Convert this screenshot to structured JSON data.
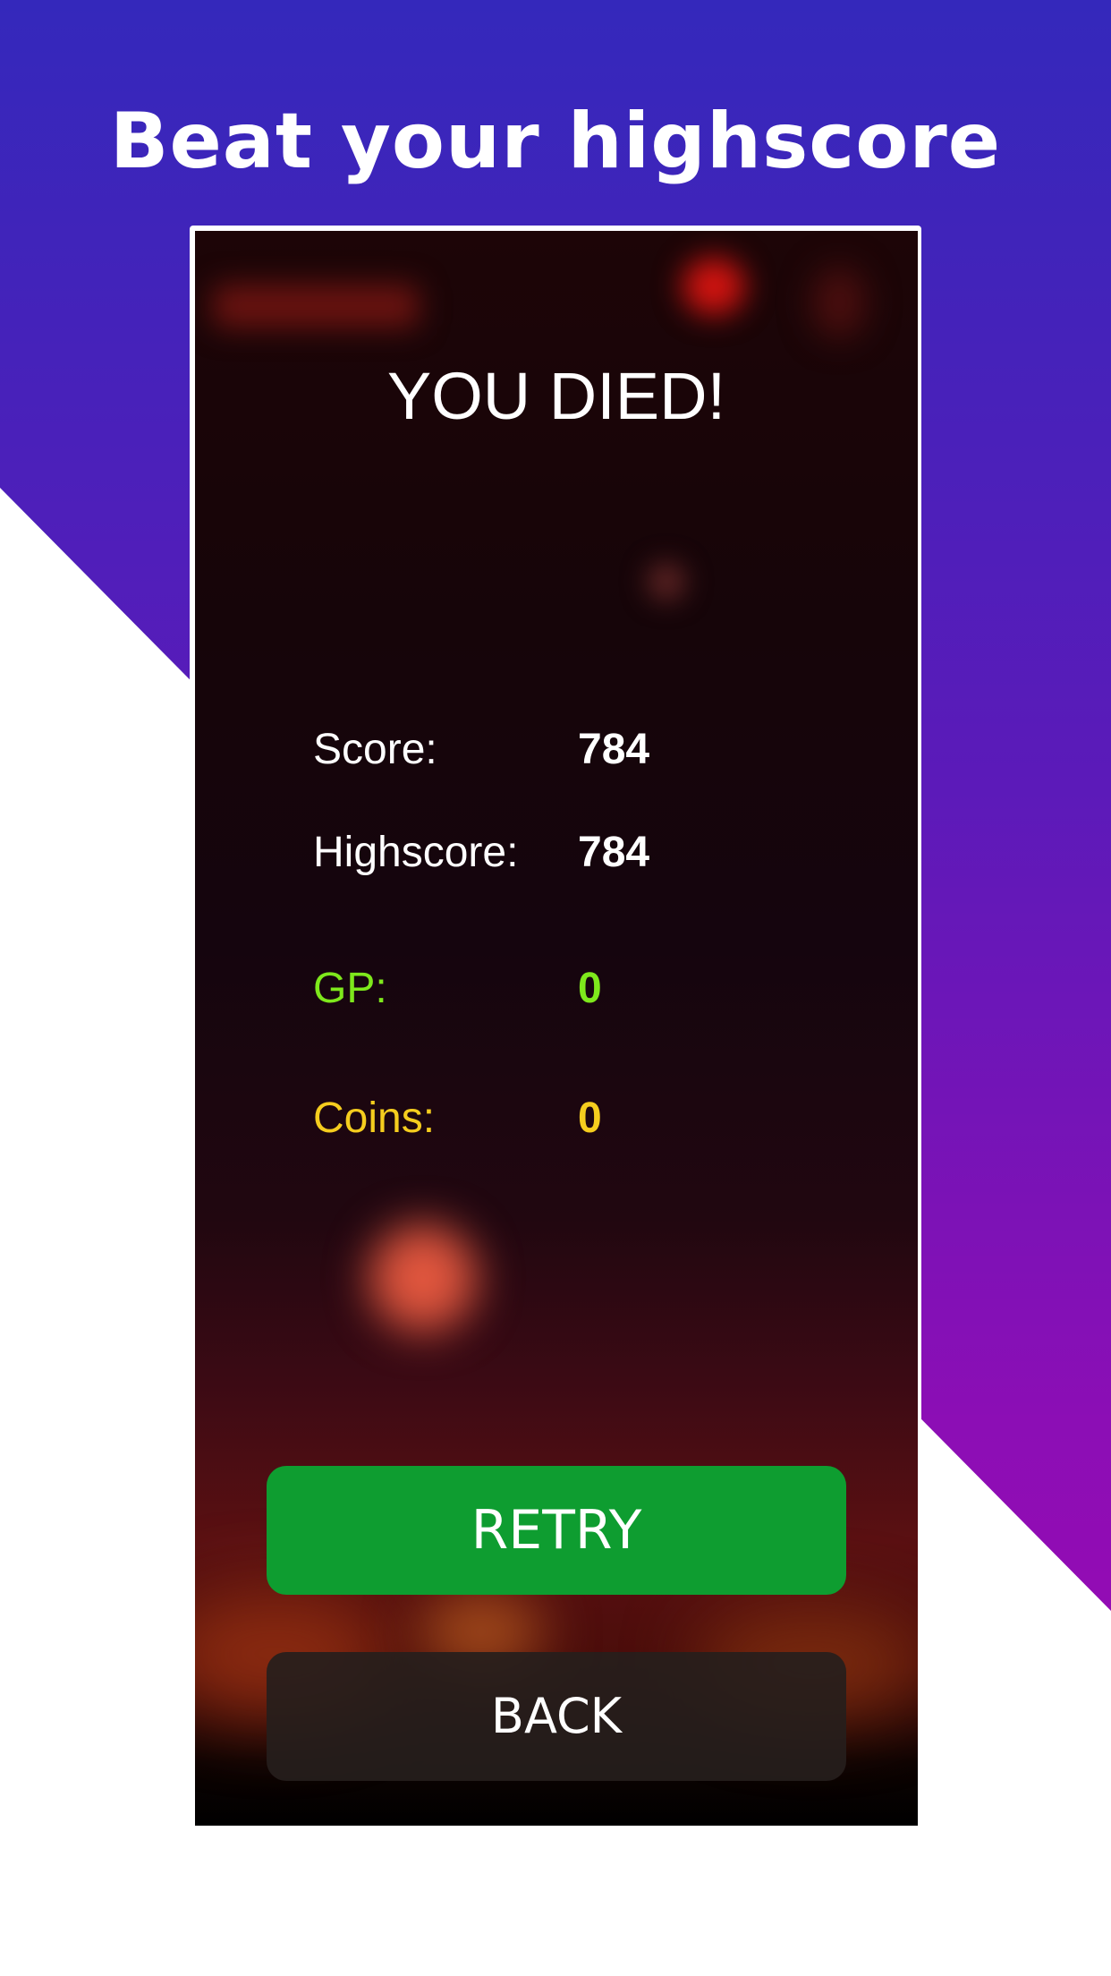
{
  "promo": {
    "headline": "Beat your highscore",
    "colors": {
      "gradient_top": "#3428bb",
      "gradient_bottom": "#a006b2"
    }
  },
  "game_over": {
    "title": "YOU DIED!",
    "stats": [
      {
        "label": "Score:",
        "value": "784",
        "color": "#ffffff"
      },
      {
        "label": "Highscore:",
        "value": "784",
        "color": "#ffffff"
      },
      {
        "label": "GP:",
        "value": "0",
        "color": "#7ee81c"
      },
      {
        "label": "Coins:",
        "value": "0",
        "color": "#f5cd1e"
      }
    ],
    "buttons": {
      "retry_label": "RETRY",
      "back_label": "BACK"
    },
    "colors": {
      "retry": "#0e9d30",
      "back": "#261e1c"
    }
  }
}
